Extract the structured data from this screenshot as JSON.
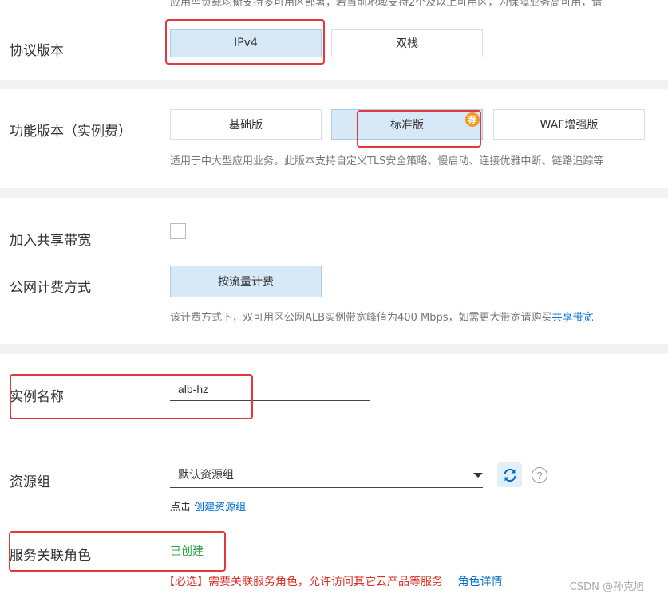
{
  "top_note": "应用型负载均衡支持多可用区部署，若当前地域支持2个及以上可用区，为保障业务高可用，请",
  "protocol": {
    "label": "协议版本",
    "options": [
      "IPv4",
      "双栈"
    ],
    "selected": "IPv4"
  },
  "edition": {
    "label": "功能版本（实例费）",
    "options": [
      "基础版",
      "标准版",
      "WAF增强版"
    ],
    "selected": "标准版",
    "recommend_badge": "荐",
    "description": "适用于中大型应用业务。此版本支持自定义TLS安全策略、慢启动、连接优雅中断、链路追踪等"
  },
  "shared_bandwidth": {
    "label": "加入共享带宽",
    "checked": false
  },
  "billing": {
    "label": "公网计费方式",
    "option": "按流量计费",
    "note_prefix": "该计费方式下，双可用区公网ALB实例带宽峰值为400 Mbps，如需更大带宽请购买",
    "note_link": "共享带宽"
  },
  "instance_name": {
    "label": "实例名称",
    "value": "alb-hz"
  },
  "resource_group": {
    "label": "资源组",
    "selected": "默认资源组",
    "hint_prefix": "点击",
    "hint_link": "创建资源组"
  },
  "service_role": {
    "label": "服务关联角色",
    "status": "已创建",
    "required_note": "【必选】需要关联服务角色，允许访问其它云产品等服务",
    "detail_link": "角色详情"
  },
  "watermark": "CSDN @孙克旭",
  "colors": {
    "accent": "#0070cc",
    "highlight": "#e4393c",
    "success": "#2fa547",
    "selected_bg": "#d7e8f6"
  }
}
